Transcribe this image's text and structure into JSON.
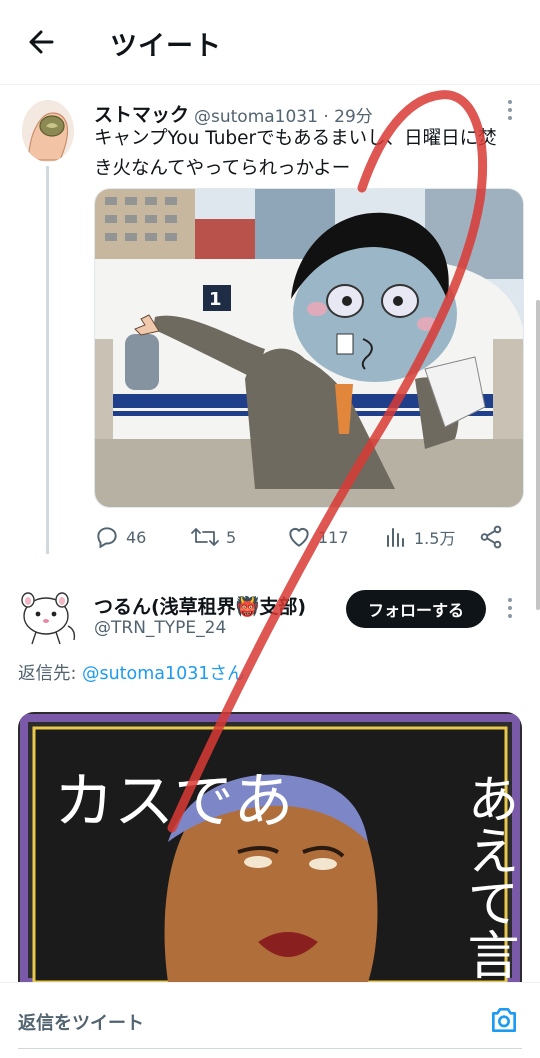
{
  "header": {
    "title": "ツイート"
  },
  "tweet": {
    "display_name": "ストマック",
    "handle_time": "@sutoma1031 · 29分",
    "text_line1": "キャンプYou Tuberでもあるまいし、日曜日に焚",
    "text_line2": "き火なんてやってられっかよー",
    "stats": {
      "replies": "46",
      "retweets": "5",
      "likes": "117",
      "views": "1.5万"
    },
    "image_sign": "1"
  },
  "reply": {
    "display_name": "つるん(浅草租界👹支部)",
    "handle": "@TRN_TYPE_24",
    "follow_label": "フォローする",
    "reply_prefix": "返信先: ",
    "reply_target": "@sutoma1031さん",
    "image_text_left": "カスであ",
    "image_text_right": "あえて言お"
  },
  "composer": {
    "placeholder": "返信をツイート"
  },
  "colors": {
    "accent": "#1d9bf0",
    "text": "#0f1419",
    "muted": "#536471",
    "annotation": "#d83a34"
  }
}
